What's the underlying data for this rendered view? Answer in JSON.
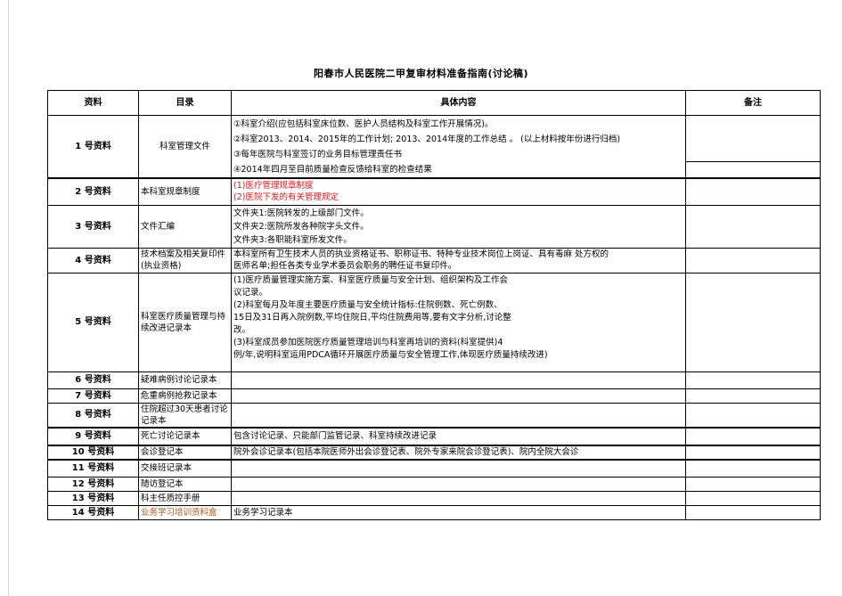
{
  "title": "阳春市人民医院二甲复审材料准备指南(讨论稿)",
  "headers": {
    "col1": "资料",
    "col2": "目录",
    "col3": "具体内容",
    "col4": "备注"
  },
  "rows": [
    {
      "label": "1 号资料",
      "directory": "科室管理文件",
      "content": [
        "①科室介绍(应包括科室床位数、医护人员结构及科室工作开展情况)。",
        "②科室2013、2014、2015年的工作计划; 2013、2014年度的工作总结 。 (以上材料按年份进行归档)",
        "③每年医院与科室签订的业务目标管理责任书",
        "④2014年四月至目前质量检查反馈给科室的检查结果"
      ],
      "note": ""
    },
    {
      "label": "2 号资料",
      "directory": "本科室规章制度",
      "content": [
        "(1)医疗管理规章制度",
        "(2)医院下发的有关管理规定"
      ],
      "content_color": "#e8141c",
      "note": ""
    },
    {
      "label": "3 号资料",
      "directory": "文件汇编",
      "content": [
        "文件夹1:医院转发的上级部门文件。",
        "文件夹2:医院所发各种院字头文件。",
        "文件夹3:各职能科室所发文件。"
      ],
      "note": ""
    },
    {
      "label": "4 号资料",
      "directory": "技术档案及相关复印件(执业资格)",
      "content": [
        "本科室所有卫生技术人员的执业资格证书、职称证书、特种专业技术岗位上岗证、具有毒麻 处方权的",
        "医师名单;担任各类专业学术委员会职务的聘任证书复印件。"
      ],
      "note": ""
    },
    {
      "label": "5 号资料",
      "directory": "科室医疗质量管理与持续改进记录本",
      "content": [
        "(1)医疗质量管理实施方案、科室医疗质量与安全计划、组织架构及工作会",
        "议记录。",
        "(2)科室每月及年度主要医疗质量与安全统计指标:住院例数、死亡例数、",
        "15日及31日再入院例数,平均住院日,平均住院费用等,要有文字分析,讨论整",
        "改。",
        "(3)科室成员参加医院医疗质量管理培训与科室再培训的资料(科室提供)4",
        "例/年,说明科室运用PDCA循环开展医疗质量与安全管理工作,体现医疗质量持续改进)"
      ],
      "note": ""
    },
    {
      "label": "6 号资料",
      "directory": "疑难病例讨论记录本",
      "content": [],
      "note": ""
    },
    {
      "label": "7 号资料",
      "directory": "危重病例抢救记录本",
      "content": [],
      "note": ""
    },
    {
      "label": "8 号资料",
      "directory": "住院超过30天患者讨论记录本",
      "content": [],
      "note": ""
    },
    {
      "label": "9 号资料",
      "directory": "死亡讨论记录本",
      "content": [
        "包含讨论记录、只能部门监管记录、科室持续改进记录"
      ],
      "note": ""
    },
    {
      "label": "10 号资料",
      "directory": "会诊登记本",
      "content": [
        "院外会诊记录本(包括本院医师外出会诊登记表、院外专家来院会诊登记表)、院内全院大会诊"
      ],
      "note": ""
    },
    {
      "label": "11 号资料",
      "directory": "交接班记录本",
      "content": [],
      "note": ""
    },
    {
      "label": "12 号资料",
      "directory": "随访登记本",
      "content": [],
      "note": ""
    },
    {
      "label": "13 号资料",
      "directory": "科主任质控手册",
      "content": [],
      "note": ""
    },
    {
      "label": "14 号资料",
      "directory": "业务学习培训资料盒",
      "directory_color": "#b8561d",
      "content": [
        "业务学习记录本"
      ],
      "note": ""
    }
  ]
}
